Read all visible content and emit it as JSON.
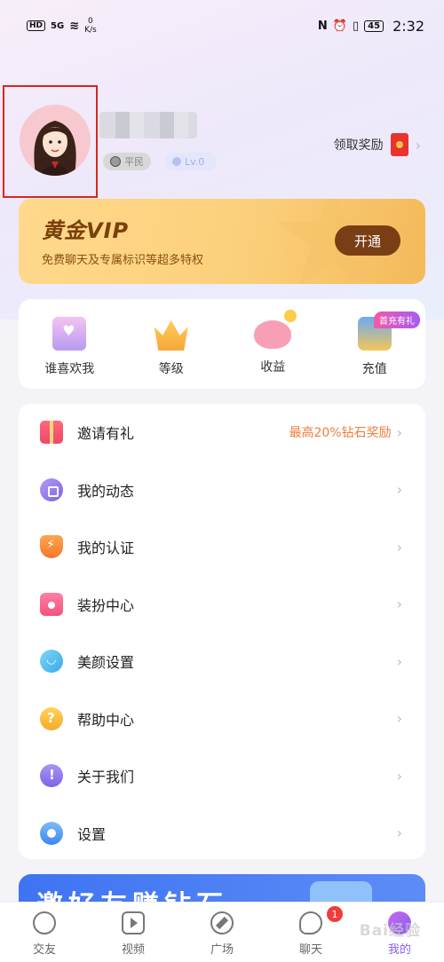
{
  "status_bar": {
    "hd": "HD",
    "signal": "5G",
    "speed_value": "0",
    "speed_unit": "K/s",
    "battery": "45",
    "time": "2:32"
  },
  "profile": {
    "reward_label": "领取奖励",
    "rank_badge": "平民",
    "level_badge": "Lv.0"
  },
  "vip": {
    "title": "黄金VIP",
    "subtitle": "免费聊天及专属标识等超多特权",
    "button": "开通"
  },
  "quick": {
    "items": [
      {
        "label": "谁喜欢我",
        "icon": "envelope-heart-icon"
      },
      {
        "label": "等级",
        "icon": "crown-icon"
      },
      {
        "label": "收益",
        "icon": "piggy-bank-icon"
      },
      {
        "label": "充值",
        "icon": "wallet-icon"
      }
    ],
    "tag": "首充有礼"
  },
  "menu": {
    "items": [
      {
        "label": "邀请有礼",
        "extra": "最高20%钻石奖励",
        "icon": "gift-icon"
      },
      {
        "label": "我的动态",
        "icon": "moment-icon"
      },
      {
        "label": "我的认证",
        "icon": "verify-shield-icon"
      },
      {
        "label": "装扮中心",
        "icon": "dress-icon"
      },
      {
        "label": "美颜设置",
        "icon": "beauty-face-icon"
      },
      {
        "label": "帮助中心",
        "icon": "help-icon"
      },
      {
        "label": "关于我们",
        "icon": "about-icon"
      },
      {
        "label": "设置",
        "icon": "settings-icon"
      }
    ]
  },
  "banner": {
    "text": "邀好友赚钻石"
  },
  "tabbar": {
    "items": [
      {
        "label": "交友",
        "icon": "friend-heart-icon"
      },
      {
        "label": "视频",
        "icon": "video-icon"
      },
      {
        "label": "广场",
        "icon": "compass-icon"
      },
      {
        "label": "聊天",
        "icon": "chat-icon",
        "badge": "1"
      },
      {
        "label": "我的",
        "icon": "me-icon",
        "active": true
      }
    ]
  },
  "watermark": "Bai经验",
  "colors": {
    "accent": "#8b5cf2",
    "vip_button": "#7a3e15",
    "promo_text": "#ef7c3b",
    "badge_red": "#f23b3b"
  }
}
